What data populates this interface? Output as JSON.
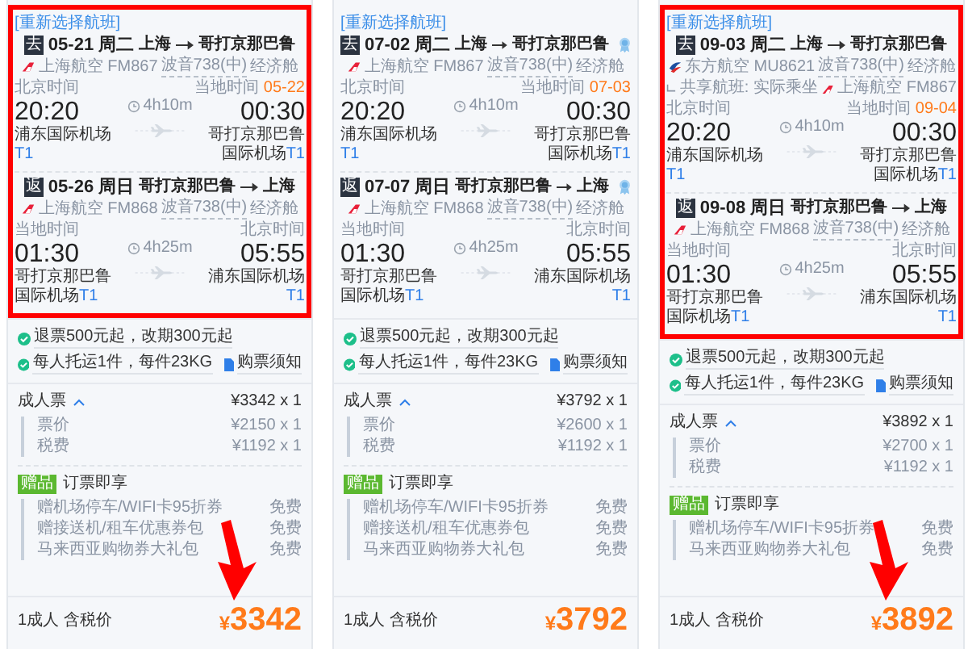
{
  "panels": [
    {
      "highlighted": true,
      "arrow": true,
      "reselect_link": "[重新选择航班]",
      "legs": [
        {
          "tag": "去",
          "date": "05-21",
          "weekday": "周二",
          "from": "上海",
          "to": "哥打京那巴鲁",
          "medal": false,
          "airline": {
            "kind": "shanghai",
            "name": "上海航空 FM867"
          },
          "aircraft": "波音738(中)",
          "cabin": "经济舱",
          "depart": {
            "label": "北京时间",
            "time": "20:20",
            "airport": "浦东国际机场",
            "terminal": "T1"
          },
          "duration": "4h10m",
          "arrive": {
            "label": "当地时间",
            "date_note": "05-22",
            "time": "00:30",
            "airport": "哥打京那巴鲁国际机场",
            "terminal": "T1"
          }
        },
        {
          "tag": "返",
          "date": "05-26",
          "weekday": "周日",
          "from": "哥打京那巴鲁",
          "to": "上海",
          "medal": false,
          "airline": {
            "kind": "shanghai",
            "name": "上海航空 FM868"
          },
          "aircraft": "波音738(中)",
          "cabin": "经济舱",
          "depart": {
            "label": "当地时间",
            "time": "01:30",
            "airport": "哥打京那巴鲁国际机场",
            "terminal": "T1"
          },
          "duration": "4h25m",
          "arrive": {
            "label": "北京时间",
            "time": "05:55",
            "airport": "浦东国际机场",
            "terminal": "T1"
          }
        }
      ],
      "policies": [
        "退票500元起，改期300元起",
        "每人托运1件，每件23KG"
      ],
      "notice_link": "购票须知",
      "fare": {
        "label": "成人票",
        "total": "¥3342 x 1",
        "items": [
          {
            "label": "票价",
            "value": "¥2150 x 1"
          },
          {
            "label": "税费",
            "value": "¥1192 x 1"
          }
        ]
      },
      "gifts": {
        "tag": "赠品",
        "title": "订票即享",
        "items": [
          {
            "label": "赠机场停车/WIFI卡95折券",
            "value": "免费"
          },
          {
            "label": "赠接送机/租车优惠券包",
            "value": "免费"
          },
          {
            "label": "马来西亚购物券大礼包",
            "value": "免费"
          }
        ]
      },
      "footer": {
        "label": "1成人 含税价",
        "currency": "¥",
        "price": "3342"
      }
    },
    {
      "highlighted": false,
      "arrow": false,
      "reselect_link": "[重新选择航班]",
      "legs": [
        {
          "tag": "去",
          "date": "07-02",
          "weekday": "周二",
          "from": "上海",
          "to": "哥打京那巴鲁",
          "medal": true,
          "airline": {
            "kind": "shanghai",
            "name": "上海航空 FM867"
          },
          "aircraft": "波音738(中)",
          "cabin": "经济舱",
          "depart": {
            "label": "北京时间",
            "time": "20:20",
            "airport": "浦东国际机场",
            "terminal": "T1"
          },
          "duration": "4h10m",
          "arrive": {
            "label": "当地时间",
            "date_note": "07-03",
            "time": "00:30",
            "airport": "哥打京那巴鲁国际机场",
            "terminal": "T1"
          }
        },
        {
          "tag": "返",
          "date": "07-07",
          "weekday": "周日",
          "from": "哥打京那巴鲁",
          "to": "上海",
          "medal": true,
          "airline": {
            "kind": "shanghai",
            "name": "上海航空 FM868"
          },
          "aircraft": "波音738(中)",
          "cabin": "经济舱",
          "depart": {
            "label": "当地时间",
            "time": "01:30",
            "airport": "哥打京那巴鲁国际机场",
            "terminal": "T1"
          },
          "duration": "4h25m",
          "arrive": {
            "label": "北京时间",
            "time": "05:55",
            "airport": "浦东国际机场",
            "terminal": "T1"
          }
        }
      ],
      "policies": [
        "退票500元起，改期300元起",
        "每人托运1件，每件23KG"
      ],
      "notice_link": "购票须知",
      "fare": {
        "label": "成人票",
        "total": "¥3792 x 1",
        "items": [
          {
            "label": "票价",
            "value": "¥2600 x 1"
          },
          {
            "label": "税费",
            "value": "¥1192 x 1"
          }
        ]
      },
      "gifts": {
        "tag": "赠品",
        "title": "订票即享",
        "items": [
          {
            "label": "赠机场停车/WIFI卡95折券",
            "value": "免费"
          },
          {
            "label": "赠接送机/租车优惠券包",
            "value": "免费"
          },
          {
            "label": "马来西亚购物券大礼包",
            "value": "免费"
          }
        ]
      },
      "footer": {
        "label": "1成人 含税价",
        "currency": "¥",
        "price": "3792"
      }
    },
    {
      "highlighted": true,
      "arrow": true,
      "reselect_link": "[重新选择航班]",
      "legs": [
        {
          "tag": "去",
          "date": "09-03",
          "weekday": "周二",
          "from": "上海",
          "to": "哥打京那巴鲁",
          "medal": false,
          "airline": {
            "kind": "eastern",
            "name": "东方航空 MU8621"
          },
          "aircraft": "波音738(中)",
          "cabin": "经济舱",
          "codeshare": {
            "note": "共享航班: 实际乘坐",
            "kind": "shanghai",
            "name": "上海航空 FM867"
          },
          "depart": {
            "label": "北京时间",
            "time": "20:20",
            "airport": "浦东国际机场",
            "terminal": "T1"
          },
          "duration": "4h10m",
          "arrive": {
            "label": "当地时间",
            "date_note": "09-04",
            "time": "00:30",
            "airport": "哥打京那巴鲁国际机场",
            "terminal": "T1"
          }
        },
        {
          "tag": "返",
          "date": "09-08",
          "weekday": "周日",
          "from": "哥打京那巴鲁",
          "to": "上海",
          "medal": false,
          "airline": {
            "kind": "shanghai",
            "name": "上海航空 FM868"
          },
          "aircraft": "波音738(中)",
          "cabin": "经济舱",
          "depart": {
            "label": "当地时间",
            "time": "01:30",
            "airport": "哥打京那巴鲁国际机场",
            "terminal": "T1"
          },
          "duration": "4h25m",
          "arrive": {
            "label": "北京时间",
            "time": "05:55",
            "airport": "浦东国际机场",
            "terminal": "T1"
          }
        }
      ],
      "policies": [
        "退票500元起，改期300元起",
        "每人托运1件，每件23KG"
      ],
      "notice_link": "购票须知",
      "fare": {
        "label": "成人票",
        "total": "¥3892 x 1",
        "items": [
          {
            "label": "票价",
            "value": "¥2700 x 1"
          },
          {
            "label": "税费",
            "value": "¥1192 x 1"
          }
        ]
      },
      "gifts": {
        "tag": "赠品",
        "title": "订票即享",
        "items": [
          {
            "label": "赠机场停车/WIFI卡95折券",
            "value": "免费"
          },
          {
            "label": "马来西亚购物券大礼包",
            "value": "免费"
          }
        ]
      },
      "footer": {
        "label": "1成人 含税价",
        "currency": "¥",
        "price": "3892"
      }
    }
  ]
}
